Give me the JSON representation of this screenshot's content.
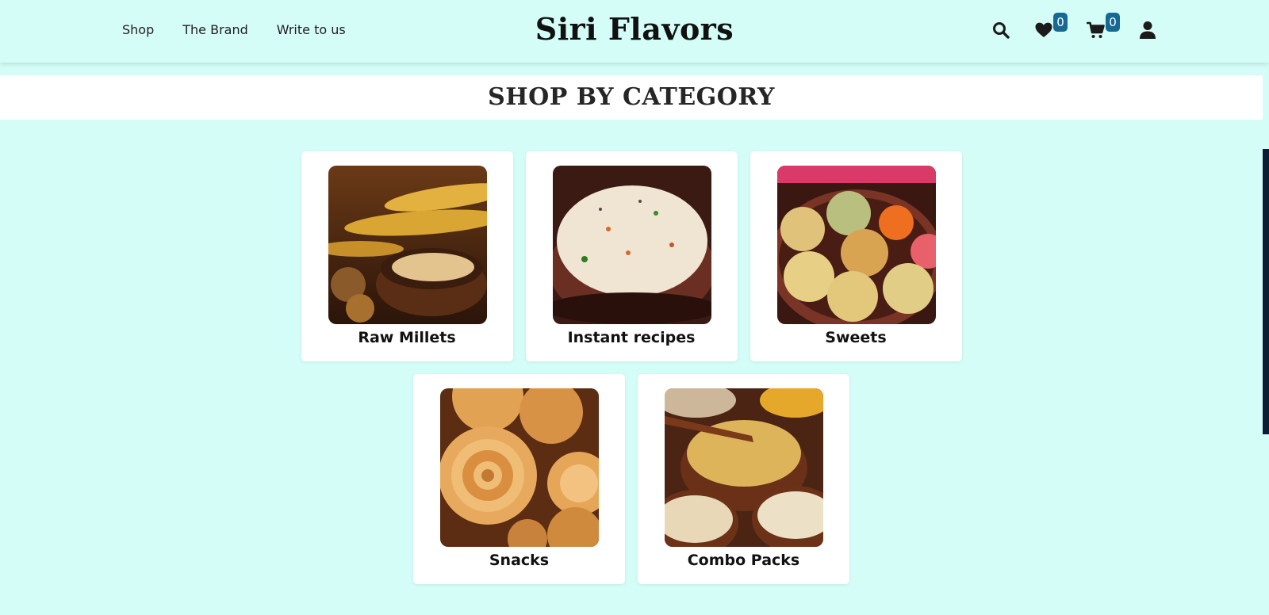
{
  "nav": {
    "links": [
      "Shop",
      "The Brand",
      "Write to us"
    ]
  },
  "brand": "Siri Flavors",
  "header_icons": {
    "search": "search-icon",
    "wishlist": "heart-icon",
    "wishlist_count": "0",
    "cart": "cart-icon",
    "cart_count": "0",
    "account": "user-icon"
  },
  "section": {
    "title": "SHOP BY CATEGORY"
  },
  "categories": [
    {
      "label": "Raw Millets"
    },
    {
      "label": "Instant recipes"
    },
    {
      "label": "Sweets"
    },
    {
      "label": "Snacks"
    },
    {
      "label": "Combo Packs"
    }
  ],
  "colors": {
    "background": "#d4fdf8",
    "badge": "#166a92",
    "text": "#111111"
  }
}
